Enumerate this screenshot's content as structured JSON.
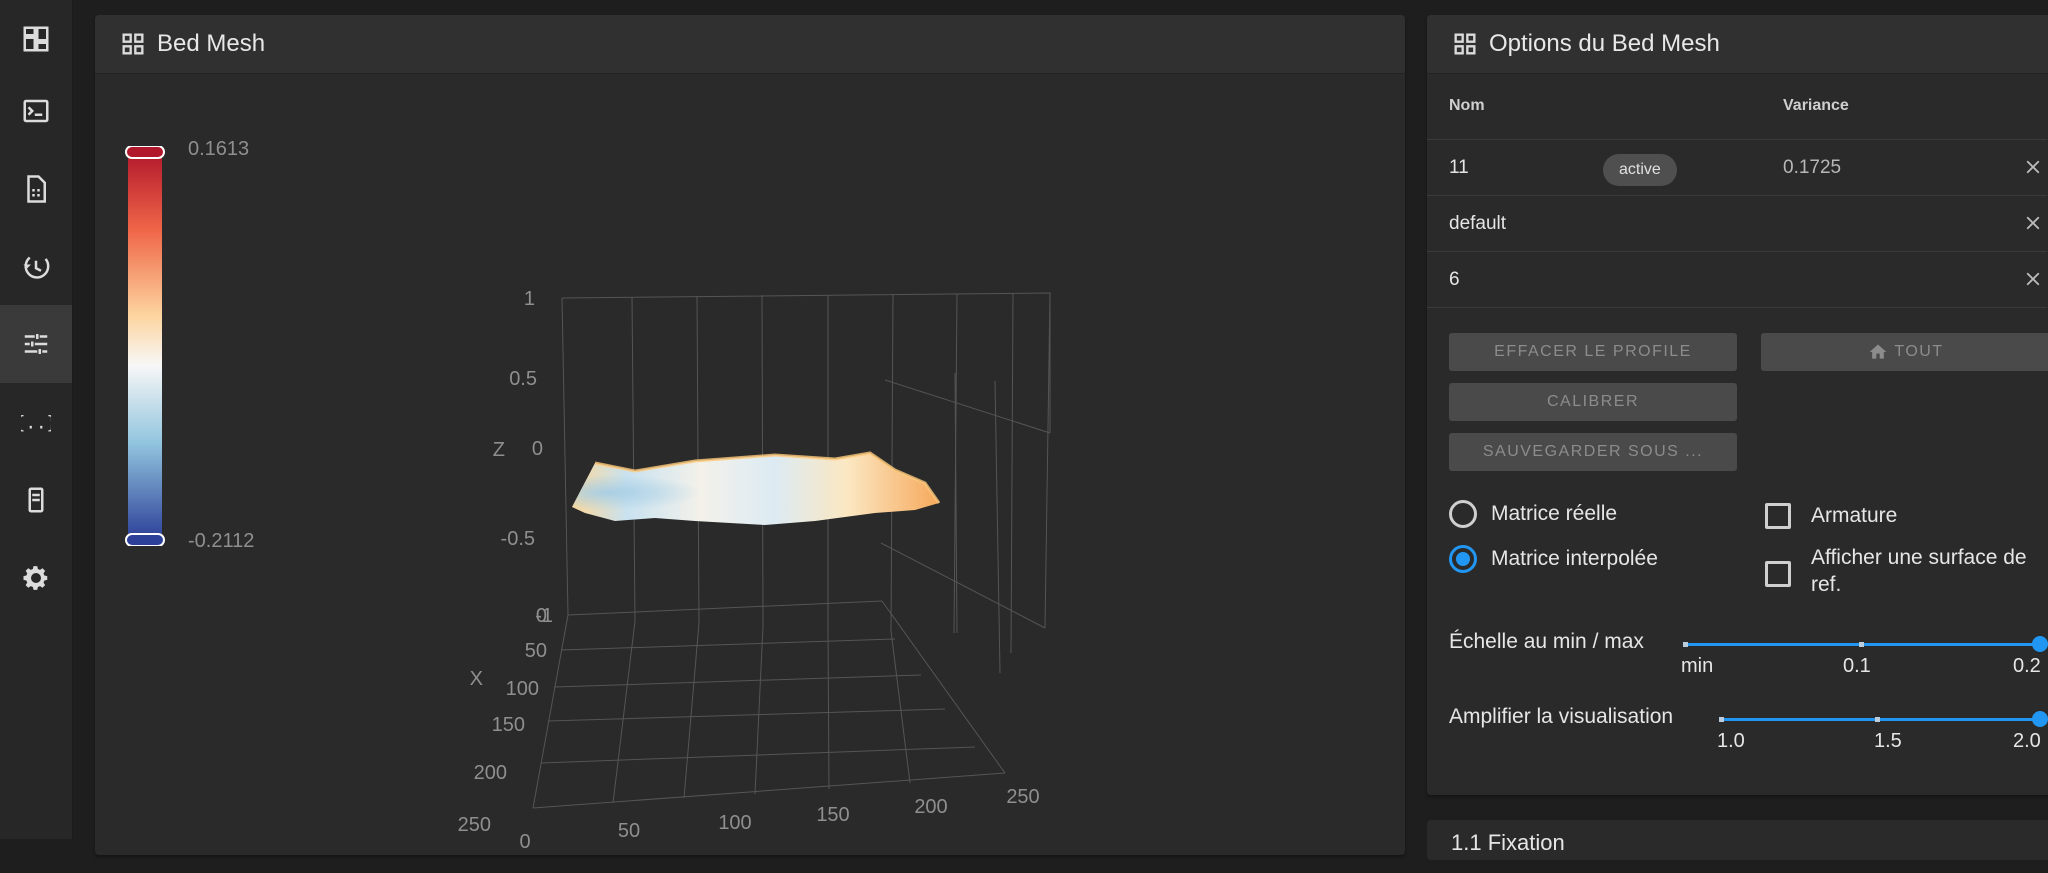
{
  "nav": {
    "items": [
      {
        "icon": "dashboard-icon"
      },
      {
        "icon": "console-icon"
      },
      {
        "icon": "file-document-icon"
      },
      {
        "icon": "history-icon"
      },
      {
        "icon": "tune-icon",
        "active": true
      },
      {
        "icon": "code-braces-icon"
      },
      {
        "icon": "server-icon"
      },
      {
        "icon": "gear-icon"
      }
    ]
  },
  "bed_mesh_card": {
    "title": "Bed Mesh",
    "colorbar": {
      "max": "0.1613",
      "min": "-0.2112"
    },
    "axes": {
      "z_label": "Z",
      "x_label": "X",
      "z_ticks": [
        "1",
        "0.5",
        "0",
        "-0.5",
        "-1"
      ],
      "x_ticks": [
        "0",
        "50",
        "100",
        "150",
        "200",
        "250"
      ],
      "y_ticks": [
        "0",
        "50",
        "100",
        "150",
        "200",
        "250"
      ]
    }
  },
  "options_card": {
    "title": "Options du Bed Mesh",
    "table": {
      "headers": {
        "name": "Nom",
        "variance": "Variance"
      },
      "rows": [
        {
          "name": "11",
          "badge": "active",
          "variance": "0.1725"
        },
        {
          "name": "default",
          "badge": "",
          "variance": ""
        },
        {
          "name": "6",
          "badge": "",
          "variance": ""
        }
      ]
    },
    "buttons": {
      "clear": "EFFACER LE PROFILE",
      "home": "TOUT",
      "calibrate": "CALIBRER",
      "save_as": "SAUVEGARDER SOUS ..."
    },
    "radios": {
      "real": "Matrice réelle",
      "interpolated": "Matrice interpolée",
      "selected": "interpolated"
    },
    "checks": {
      "wireframe": "Armature",
      "flat_surface": "Afficher une surface de ref."
    },
    "scale_slider": {
      "label": "Échelle au min / max",
      "ticks": [
        "min",
        "0.1",
        "0.2"
      ],
      "value": "0.2"
    },
    "amplify_slider": {
      "label": "Amplifier la visualisation",
      "ticks": [
        "1.0",
        "1.5",
        "2.0"
      ],
      "value": "2.0"
    }
  },
  "bottom_card": {
    "title": "1.1 Fixation"
  },
  "colors": {
    "accent": "#2196f3",
    "hot": "#c62828",
    "cold": "#283593"
  }
}
